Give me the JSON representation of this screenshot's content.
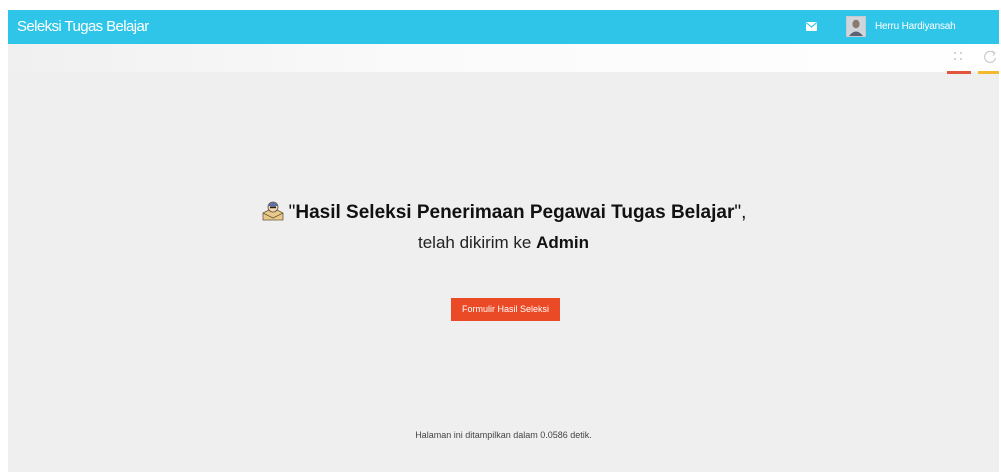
{
  "header": {
    "title": "Seleksi Tugas Belajar",
    "user_name": "Herru Hardiyansah",
    "icons": [
      "mail-icon",
      "user-avatar"
    ]
  },
  "toolbar": {
    "icons": [
      "grid-icon",
      "refresh-icon"
    ],
    "colors": {
      "grid_underline": "#e2543b",
      "refresh_underline": "#f5b92e"
    }
  },
  "message": {
    "open_quote": "\"",
    "title": "Hasil Seleksi Penerimaan Pegawai Tugas Belajar",
    "close_quote": "\",",
    "line2_prefix": "telah dikirim ke",
    "recipient": "Admin",
    "icon": "mail-user-icon"
  },
  "actions": {
    "form_button_label": "Formulir Hasil Seleksi"
  },
  "footer": {
    "text": "Halaman ini ditampilkan dalam 0.0586 detik."
  },
  "colors": {
    "header_bg": "#2fc5e9",
    "page_bg": "#efefef",
    "button_bg": "#ea4a25"
  }
}
